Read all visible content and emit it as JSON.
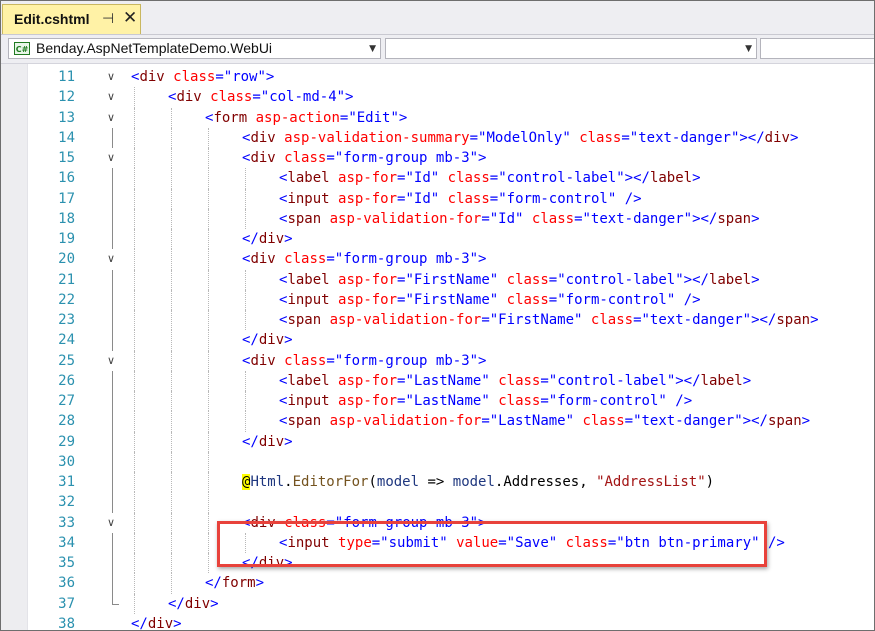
{
  "tab": {
    "title": "Edit.cshtml",
    "pin_glyph": "⊣",
    "close_glyph": "✕"
  },
  "nav": {
    "project": "Benday.AspNetTemplateDemo.WebUi",
    "type_member": "",
    "right_member": ""
  },
  "colors": {
    "tab_active": "#fff2a6",
    "highlight_border": "#e8423b",
    "line_number": "#2b91af",
    "tag": "#800000",
    "attribute": "#ff0000",
    "value": "#0000ff"
  },
  "code_lines": [
    {
      "n": "11",
      "indent": 0,
      "fold": "open",
      "tokens": [
        [
          "p",
          "<"
        ],
        [
          "t",
          "div"
        ],
        [
          "pl",
          " "
        ],
        [
          "a",
          "class"
        ],
        [
          "p",
          "=\""
        ],
        [
          "v",
          "row"
        ],
        [
          "p",
          "\">"
        ]
      ]
    },
    {
      "n": "12",
      "indent": 1,
      "fold": "open",
      "tokens": [
        [
          "p",
          "<"
        ],
        [
          "t",
          "div"
        ],
        [
          "pl",
          " "
        ],
        [
          "a",
          "class"
        ],
        [
          "p",
          "=\""
        ],
        [
          "v",
          "col-md-4"
        ],
        [
          "p",
          "\">"
        ]
      ]
    },
    {
      "n": "13",
      "indent": 2,
      "fold": "open",
      "tokens": [
        [
          "p",
          "<"
        ],
        [
          "t",
          "form"
        ],
        [
          "pl",
          " "
        ],
        [
          "a",
          "asp-action"
        ],
        [
          "p",
          "=\""
        ],
        [
          "v",
          "Edit"
        ],
        [
          "p",
          "\">"
        ]
      ]
    },
    {
      "n": "14",
      "indent": 3,
      "fold": "",
      "tokens": [
        [
          "p",
          "<"
        ],
        [
          "t",
          "div"
        ],
        [
          "pl",
          " "
        ],
        [
          "a",
          "asp-validation-summary"
        ],
        [
          "p",
          "=\""
        ],
        [
          "v",
          "ModelOnly"
        ],
        [
          "p",
          "\""
        ],
        [
          "pl",
          " "
        ],
        [
          "a",
          "class"
        ],
        [
          "p",
          "=\""
        ],
        [
          "v",
          "text-danger"
        ],
        [
          "p",
          "\"></"
        ],
        [
          "t",
          "div"
        ],
        [
          "p",
          ">"
        ]
      ]
    },
    {
      "n": "15",
      "indent": 3,
      "fold": "open",
      "tokens": [
        [
          "p",
          "<"
        ],
        [
          "t",
          "div"
        ],
        [
          "pl",
          " "
        ],
        [
          "a",
          "class"
        ],
        [
          "p",
          "=\""
        ],
        [
          "v",
          "form-group mb-3"
        ],
        [
          "p",
          "\">"
        ]
      ]
    },
    {
      "n": "16",
      "indent": 4,
      "fold": "",
      "tokens": [
        [
          "p",
          "<"
        ],
        [
          "t",
          "label"
        ],
        [
          "pl",
          " "
        ],
        [
          "a",
          "asp-for"
        ],
        [
          "p",
          "=\""
        ],
        [
          "v",
          "Id"
        ],
        [
          "p",
          "\""
        ],
        [
          "pl",
          " "
        ],
        [
          "a",
          "class"
        ],
        [
          "p",
          "=\""
        ],
        [
          "v",
          "control-label"
        ],
        [
          "p",
          "\"></"
        ],
        [
          "t",
          "label"
        ],
        [
          "p",
          ">"
        ]
      ]
    },
    {
      "n": "17",
      "indent": 4,
      "fold": "",
      "tokens": [
        [
          "p",
          "<"
        ],
        [
          "t",
          "input"
        ],
        [
          "pl",
          " "
        ],
        [
          "a",
          "asp-for"
        ],
        [
          "p",
          "=\""
        ],
        [
          "v",
          "Id"
        ],
        [
          "p",
          "\""
        ],
        [
          "pl",
          " "
        ],
        [
          "a",
          "class"
        ],
        [
          "p",
          "=\""
        ],
        [
          "v",
          "form-control"
        ],
        [
          "p",
          "\""
        ],
        [
          "pl",
          " "
        ],
        [
          "p",
          "/>"
        ]
      ]
    },
    {
      "n": "18",
      "indent": 4,
      "fold": "",
      "tokens": [
        [
          "p",
          "<"
        ],
        [
          "t",
          "span"
        ],
        [
          "pl",
          " "
        ],
        [
          "a",
          "asp-validation-for"
        ],
        [
          "p",
          "=\""
        ],
        [
          "v",
          "Id"
        ],
        [
          "p",
          "\""
        ],
        [
          "pl",
          " "
        ],
        [
          "a",
          "class"
        ],
        [
          "p",
          "=\""
        ],
        [
          "v",
          "text-danger"
        ],
        [
          "p",
          "\"></"
        ],
        [
          "t",
          "span"
        ],
        [
          "p",
          ">"
        ]
      ]
    },
    {
      "n": "19",
      "indent": 3,
      "fold": "",
      "tokens": [
        [
          "p",
          "</"
        ],
        [
          "t",
          "div"
        ],
        [
          "p",
          ">"
        ]
      ]
    },
    {
      "n": "20",
      "indent": 3,
      "fold": "open",
      "tokens": [
        [
          "p",
          "<"
        ],
        [
          "t",
          "div"
        ],
        [
          "pl",
          " "
        ],
        [
          "a",
          "class"
        ],
        [
          "p",
          "=\""
        ],
        [
          "v",
          "form-group mb-3"
        ],
        [
          "p",
          "\">"
        ]
      ]
    },
    {
      "n": "21",
      "indent": 4,
      "fold": "",
      "tokens": [
        [
          "p",
          "<"
        ],
        [
          "t",
          "label"
        ],
        [
          "pl",
          " "
        ],
        [
          "a",
          "asp-for"
        ],
        [
          "p",
          "=\""
        ],
        [
          "v",
          "FirstName"
        ],
        [
          "p",
          "\""
        ],
        [
          "pl",
          " "
        ],
        [
          "a",
          "class"
        ],
        [
          "p",
          "=\""
        ],
        [
          "v",
          "control-label"
        ],
        [
          "p",
          "\"></"
        ],
        [
          "t",
          "label"
        ],
        [
          "p",
          ">"
        ]
      ]
    },
    {
      "n": "22",
      "indent": 4,
      "fold": "",
      "tokens": [
        [
          "p",
          "<"
        ],
        [
          "t",
          "input"
        ],
        [
          "pl",
          " "
        ],
        [
          "a",
          "asp-for"
        ],
        [
          "p",
          "=\""
        ],
        [
          "v",
          "FirstName"
        ],
        [
          "p",
          "\""
        ],
        [
          "pl",
          " "
        ],
        [
          "a",
          "class"
        ],
        [
          "p",
          "=\""
        ],
        [
          "v",
          "form-control"
        ],
        [
          "p",
          "\""
        ],
        [
          "pl",
          " "
        ],
        [
          "p",
          "/>"
        ]
      ]
    },
    {
      "n": "23",
      "indent": 4,
      "fold": "",
      "tokens": [
        [
          "p",
          "<"
        ],
        [
          "t",
          "span"
        ],
        [
          "pl",
          " "
        ],
        [
          "a",
          "asp-validation-for"
        ],
        [
          "p",
          "=\""
        ],
        [
          "v",
          "FirstName"
        ],
        [
          "p",
          "\""
        ],
        [
          "pl",
          " "
        ],
        [
          "a",
          "class"
        ],
        [
          "p",
          "=\""
        ],
        [
          "v",
          "text-danger"
        ],
        [
          "p",
          "\"></"
        ],
        [
          "t",
          "span"
        ],
        [
          "p",
          ">"
        ]
      ]
    },
    {
      "n": "24",
      "indent": 3,
      "fold": "",
      "tokens": [
        [
          "p",
          "</"
        ],
        [
          "t",
          "div"
        ],
        [
          "p",
          ">"
        ]
      ]
    },
    {
      "n": "25",
      "indent": 3,
      "fold": "open",
      "tokens": [
        [
          "p",
          "<"
        ],
        [
          "t",
          "div"
        ],
        [
          "pl",
          " "
        ],
        [
          "a",
          "class"
        ],
        [
          "p",
          "=\""
        ],
        [
          "v",
          "form-group mb-3"
        ],
        [
          "p",
          "\">"
        ]
      ]
    },
    {
      "n": "26",
      "indent": 4,
      "fold": "",
      "tokens": [
        [
          "p",
          "<"
        ],
        [
          "t",
          "label"
        ],
        [
          "pl",
          " "
        ],
        [
          "a",
          "asp-for"
        ],
        [
          "p",
          "=\""
        ],
        [
          "v",
          "LastName"
        ],
        [
          "p",
          "\""
        ],
        [
          "pl",
          " "
        ],
        [
          "a",
          "class"
        ],
        [
          "p",
          "=\""
        ],
        [
          "v",
          "control-label"
        ],
        [
          "p",
          "\"></"
        ],
        [
          "t",
          "label"
        ],
        [
          "p",
          ">"
        ]
      ]
    },
    {
      "n": "27",
      "indent": 4,
      "fold": "",
      "tokens": [
        [
          "p",
          "<"
        ],
        [
          "t",
          "input"
        ],
        [
          "pl",
          " "
        ],
        [
          "a",
          "asp-for"
        ],
        [
          "p",
          "=\""
        ],
        [
          "v",
          "LastName"
        ],
        [
          "p",
          "\""
        ],
        [
          "pl",
          " "
        ],
        [
          "a",
          "class"
        ],
        [
          "p",
          "=\""
        ],
        [
          "v",
          "form-control"
        ],
        [
          "p",
          "\""
        ],
        [
          "pl",
          " "
        ],
        [
          "p",
          "/>"
        ]
      ]
    },
    {
      "n": "28",
      "indent": 4,
      "fold": "",
      "tokens": [
        [
          "p",
          "<"
        ],
        [
          "t",
          "span"
        ],
        [
          "pl",
          " "
        ],
        [
          "a",
          "asp-validation-for"
        ],
        [
          "p",
          "=\""
        ],
        [
          "v",
          "LastName"
        ],
        [
          "p",
          "\""
        ],
        [
          "pl",
          " "
        ],
        [
          "a",
          "class"
        ],
        [
          "p",
          "=\""
        ],
        [
          "v",
          "text-danger"
        ],
        [
          "p",
          "\"></"
        ],
        [
          "t",
          "span"
        ],
        [
          "p",
          ">"
        ]
      ]
    },
    {
      "n": "29",
      "indent": 3,
      "fold": "",
      "tokens": [
        [
          "p",
          "</"
        ],
        [
          "t",
          "div"
        ],
        [
          "p",
          ">"
        ]
      ]
    },
    {
      "n": "30",
      "indent": 3,
      "fold": "",
      "tokens": []
    },
    {
      "n": "31",
      "indent": 3,
      "fold": "",
      "tokens": [
        [
          "at",
          "@"
        ],
        [
          "id",
          "Html"
        ],
        [
          "pl",
          "."
        ],
        [
          "m",
          "EditorFor"
        ],
        [
          "pl",
          "("
        ],
        [
          "id",
          "model"
        ],
        [
          "pl",
          " => "
        ],
        [
          "id",
          "model"
        ],
        [
          "pl",
          ".Addresses, "
        ],
        [
          "str",
          "\"AddressList\""
        ],
        [
          "pl",
          ")"
        ]
      ]
    },
    {
      "n": "32",
      "indent": 3,
      "fold": "",
      "tokens": []
    },
    {
      "n": "33",
      "indent": 3,
      "fold": "open",
      "tokens": [
        [
          "p",
          "<"
        ],
        [
          "t",
          "div"
        ],
        [
          "pl",
          " "
        ],
        [
          "a",
          "class"
        ],
        [
          "p",
          "=\""
        ],
        [
          "v",
          "form-group mb-3"
        ],
        [
          "p",
          "\">"
        ]
      ]
    },
    {
      "n": "34",
      "indent": 4,
      "fold": "",
      "tokens": [
        [
          "p",
          "<"
        ],
        [
          "t",
          "input"
        ],
        [
          "pl",
          " "
        ],
        [
          "a",
          "type"
        ],
        [
          "p",
          "=\""
        ],
        [
          "v",
          "submit"
        ],
        [
          "p",
          "\""
        ],
        [
          "pl",
          " "
        ],
        [
          "a",
          "value"
        ],
        [
          "p",
          "=\""
        ],
        [
          "v",
          "Save"
        ],
        [
          "p",
          "\""
        ],
        [
          "pl",
          " "
        ],
        [
          "a",
          "class"
        ],
        [
          "p",
          "=\""
        ],
        [
          "v",
          "btn btn-primary"
        ],
        [
          "p",
          "\""
        ],
        [
          "pl",
          " "
        ],
        [
          "p",
          "/>"
        ]
      ]
    },
    {
      "n": "35",
      "indent": 3,
      "fold": "",
      "tokens": [
        [
          "p",
          "</"
        ],
        [
          "t",
          "div"
        ],
        [
          "p",
          ">"
        ]
      ]
    },
    {
      "n": "36",
      "indent": 2,
      "fold": "",
      "tokens": [
        [
          "p",
          "</"
        ],
        [
          "t",
          "form"
        ],
        [
          "p",
          ">"
        ]
      ]
    },
    {
      "n": "37",
      "indent": 1,
      "fold": "end",
      "tokens": [
        [
          "p",
          "</"
        ],
        [
          "t",
          "div"
        ],
        [
          "p",
          ">"
        ]
      ]
    },
    {
      "n": "38",
      "indent": 0,
      "fold": "",
      "tokens": [
        [
          "p",
          "</"
        ],
        [
          "t",
          "div"
        ],
        [
          "p",
          ">"
        ]
      ]
    }
  ]
}
